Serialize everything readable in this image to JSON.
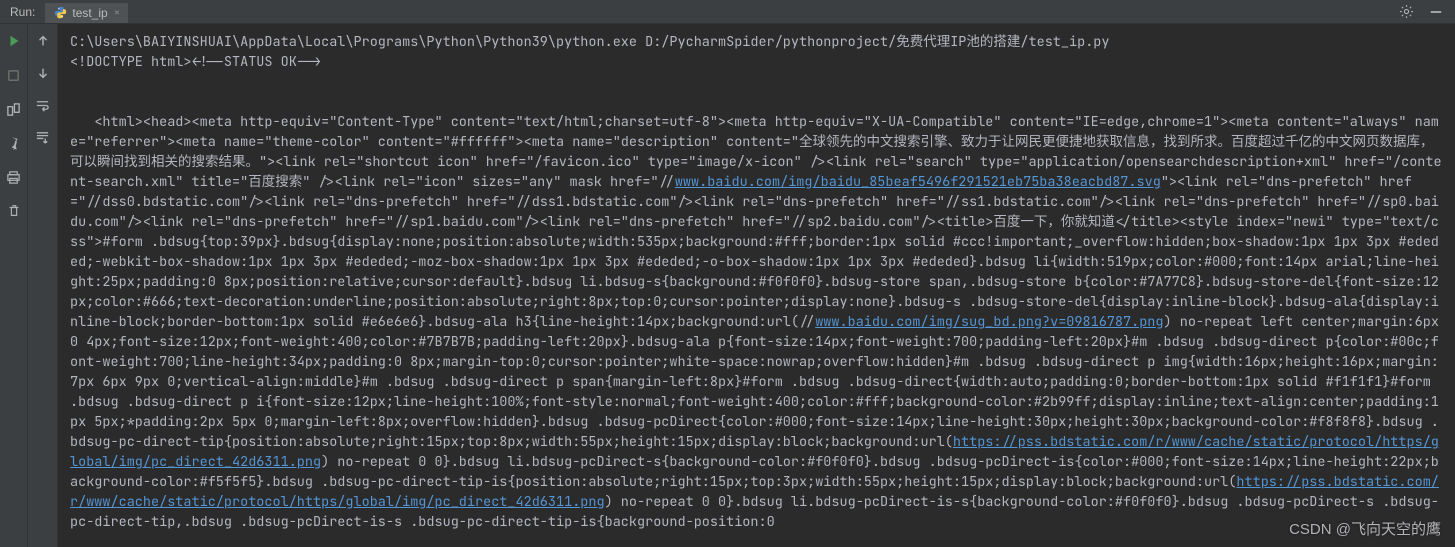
{
  "header": {
    "run_label": "Run:",
    "tab_name": "test_ip",
    "tab_close": "×"
  },
  "gutter_left": {
    "play": "play-icon",
    "rerun": "rerun-icon",
    "stop": "stop-icon",
    "structure": "structure-icon",
    "pin": "pin-icon",
    "print": "print-icon",
    "delete": "delete-icon"
  },
  "gutter_right": {
    "up": "up-icon",
    "down": "down-icon",
    "wrap": "wrap-icon",
    "scroll": "scroll-icon"
  },
  "header_right": {
    "gear": "settings-icon",
    "minus": "minimize-icon"
  },
  "console": {
    "line1": "C:\\Users\\BAIYINSHUAI\\AppData\\Local\\Programs\\Python\\Python39\\python.exe D:/PycharmSpider/pythonproject/免费代理IP池的搭建/test_ip.py",
    "line2": "<!DOCTYPE html><!--STATUS OK-->",
    "body_pre_link1": "   <html><head><meta http-equiv=\"Content-Type\" content=\"text/html;charset=utf-8\"><meta http-equiv=\"X-UA-Compatible\" content=\"IE=edge,chrome=1\"><meta content=\"always\" name=\"referrer\"><meta name=\"theme-color\" content=\"#ffffff\"><meta name=\"description\" content=\"全球领先的中文搜索引擎、致力于让网民更便捷地获取信息，找到所求。百度超过千亿的中文网页数据库，可以瞬间找到相关的搜索结果。\"><link rel=\"shortcut icon\" href=\"/favicon.ico\" type=\"image/x-icon\" /><link rel=\"search\" type=\"application/opensearchdescription+xml\" href=\"/content-search.xml\" title=\"百度搜索\" /><link rel=\"icon\" sizes=\"any\" mask href=\"//",
    "link1_text": "www.baidu.com/img/baidu_85beaf5496f291521eb75ba38eacbd87.svg",
    "body_mid1": "\"><link rel=\"dns-prefetch\" href=\"//dss0.bdstatic.com\"/><link rel=\"dns-prefetch\" href=\"//dss1.bdstatic.com\"/><link rel=\"dns-prefetch\" href=\"//ss1.bdstatic.com\"/><link rel=\"dns-prefetch\" href=\"//sp0.baidu.com\"/><link rel=\"dns-prefetch\" href=\"//sp1.baidu.com\"/><link rel=\"dns-prefetch\" href=\"//sp2.baidu.com\"/><title>百度一下，你就知道</title><style index=\"newi\" type=\"text/css\">#form .bdsug{top:39px}.bdsug{display:none;position:absolute;width:535px;background:#fff;border:1px solid #ccc!important;_overflow:hidden;box-shadow:1px 1px 3px #ededed;-webkit-box-shadow:1px 1px 3px #ededed;-moz-box-shadow:1px 1px 3px #ededed;-o-box-shadow:1px 1px 3px #ededed}.bdsug li{width:519px;color:#000;font:14px arial;line-height:25px;padding:0 8px;position:relative;cursor:default}.bdsug li.bdsug-s{background:#f0f0f0}.bdsug-store span,.bdsug-store b{color:#7A77C8}.bdsug-store-del{font-size:12px;color:#666;text-decoration:underline;position:absolute;right:8px;top:0;cursor:pointer;display:none}.bdsug-s .bdsug-store-del{display:inline-block}.bdsug-ala{display:inline-block;border-bottom:1px solid #e6e6e6}.bdsug-ala h3{line-height:14px;background:url(//",
    "link2_text": "www.baidu.com/img/sug_bd.png?v=09816787.png",
    "body_mid2": ") no-repeat left center;margin:6px 0 4px;font-size:12px;font-weight:400;color:#7B7B7B;padding-left:20px}.bdsug-ala p{font-size:14px;font-weight:700;padding-left:20px}#m .bdsug .bdsug-direct p{color:#00c;font-weight:700;line-height:34px;padding:0 8px;margin-top:0;cursor:pointer;white-space:nowrap;overflow:hidden}#m .bdsug .bdsug-direct p img{width:16px;height:16px;margin:7px 6px 9px 0;vertical-align:middle}#m .bdsug .bdsug-direct p span{margin-left:8px}#form .bdsug .bdsug-direct{width:auto;padding:0;border-bottom:1px solid #f1f1f1}#form .bdsug .bdsug-direct p i{font-size:12px;line-height:100%;font-style:normal;font-weight:400;color:#fff;background-color:#2b99ff;display:inline;text-align:center;padding:1px 5px;*padding:2px 5px 0;margin-left:8px;overflow:hidden}.bdsug .bdsug-pcDirect{color:#000;font-size:14px;line-height:30px;height:30px;background-color:#f8f8f8}.bdsug .bdsug-pc-direct-tip{position:absolute;right:15px;top:8px;width:55px;height:15px;display:block;background:url(",
    "link3_text": "https://pss.bdstatic.com/r/www/cache/static/protocol/https/global/img/pc_direct_42d6311.png",
    "body_mid3": ") no-repeat 0 0}.bdsug li.bdsug-pcDirect-s{background-color:#f0f0f0}.bdsug .bdsug-pcDirect-is{color:#000;font-size:14px;line-height:22px;background-color:#f5f5f5}.bdsug .bdsug-pc-direct-tip-is{position:absolute;right:15px;top:3px;width:55px;height:15px;display:block;background:url(",
    "link4_text": "https://pss.bdstatic.com/r/www/cache/static/protocol/https/global/img/pc_direct_42d6311.png",
    "body_post_link4": ") no-repeat 0 0}.bdsug li.bdsug-pcDirect-is-s{background-color:#f0f0f0}.bdsug .bdsug-pcDirect-s .bdsug-pc-direct-tip,.bdsug .bdsug-pcDirect-is-s .bdsug-pc-direct-tip-is{background-position:0"
  },
  "watermark": "CSDN @飞向天空的鹰"
}
